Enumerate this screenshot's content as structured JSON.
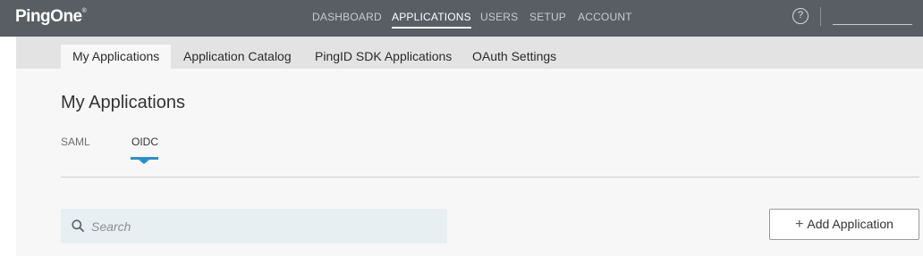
{
  "brand": {
    "name": "PingOne",
    "mark": "®"
  },
  "nav": {
    "items": [
      {
        "label": "DASHBOARD"
      },
      {
        "label": "APPLICATIONS",
        "active": true
      },
      {
        "label": "USERS"
      },
      {
        "label": "SETUP"
      },
      {
        "label": "ACCOUNT"
      }
    ],
    "help_glyph": "?"
  },
  "tabs": [
    {
      "label": "My Applications",
      "active": true
    },
    {
      "label": "Application Catalog"
    },
    {
      "label": "PingID SDK Applications"
    },
    {
      "label": "OAuth Settings"
    }
  ],
  "page": {
    "title": "My Applications",
    "subtabs": [
      {
        "label": "SAML"
      },
      {
        "label": "OIDC",
        "active": true
      }
    ]
  },
  "search": {
    "placeholder": "Search",
    "value": ""
  },
  "actions": {
    "add_label": "Add Application",
    "add_icon": "plus-icon"
  },
  "colors": {
    "topbar": "#585e64",
    "accent": "#2c8fc5",
    "search_bg": "#e8eff2"
  }
}
